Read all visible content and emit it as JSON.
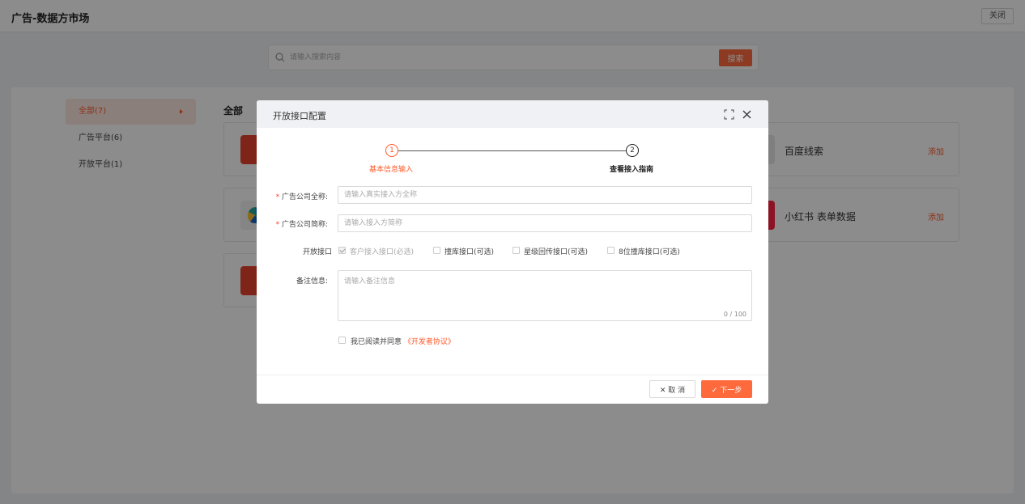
{
  "app": {
    "title": "广告-数据方市场",
    "close_label": "关闭"
  },
  "search": {
    "placeholder": "请输入搜索内容",
    "button_label": "搜索"
  },
  "sidebar": {
    "items": [
      {
        "label": "全部(7)",
        "active": true
      },
      {
        "label": "广告平台(6)",
        "active": false
      },
      {
        "label": "开放平台(1)",
        "active": false
      }
    ]
  },
  "main": {
    "section_title": "全部",
    "cards": [
      {
        "name": "百度线索",
        "add_label": "添加"
      },
      {
        "name": "小红书 表单数据",
        "add_label": "添加"
      }
    ]
  },
  "colors": {
    "accent": "#ff6a3d",
    "accent_text": "#ff5a2a",
    "logo_red": "#e8432f",
    "logo_xhs": "#ff2442"
  },
  "modal": {
    "title": "开放接口配置",
    "steps": [
      {
        "number": "1",
        "label": "基本信息输入"
      },
      {
        "number": "2",
        "label": "查看接入指南"
      }
    ],
    "fields": {
      "company_full": {
        "label": "广告公司全称:",
        "placeholder": "请输入真实接入方全称"
      },
      "company_short": {
        "label": "广告公司简称:",
        "placeholder": "请输入接入方简称"
      },
      "interfaces": {
        "label": "开放接口",
        "options": [
          {
            "label": "客户接入接口(必选)",
            "checked": true,
            "disabled": true
          },
          {
            "label": "撞库接口(可选)",
            "checked": false
          },
          {
            "label": "星级回传接口(可选)",
            "checked": false
          },
          {
            "label": "8位撞库接口(可选)",
            "checked": false
          }
        ]
      },
      "remark": {
        "label": "备注信息:",
        "placeholder": "请输入备注信息",
        "count": "0 / 100"
      }
    },
    "agreement": {
      "text": "我已阅读并同意",
      "link": "《开发者协议》"
    },
    "buttons": {
      "cancel": "取 消",
      "next": "下一步"
    }
  }
}
